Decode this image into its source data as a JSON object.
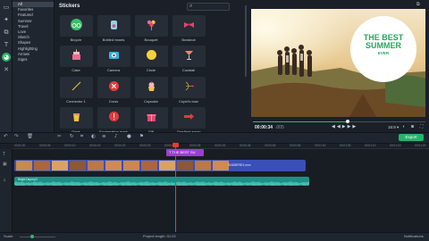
{
  "categories": [
    "All",
    "Favorites",
    "Featured",
    "Summer",
    "Travel",
    "Love",
    "Sketch",
    "Shapes",
    "Highlighting",
    "Arrows",
    "Signs"
  ],
  "stickers": {
    "title": "Stickers",
    "items": [
      "Bicycle",
      "Bottled hearts",
      "Bouquet",
      "Bowknot",
      "Cake",
      "Camera",
      "Circle",
      "Cocktail",
      "Connector 1",
      "Cross",
      "Cupcake",
      "Cupid's bow",
      "Drink",
      "Exclamation mark",
      "Gift",
      "Gradient arrow"
    ]
  },
  "preview": {
    "overlay_line1": "THE BEST",
    "overlay_line2": "SUMMER",
    "overlay_line3": "EVER",
    "time": "00:00:34",
    "time_frac": ".005",
    "aspect": "16:9 ▾"
  },
  "toolbar": {
    "export_label": "Export"
  },
  "ruler": [
    "00:00:00",
    "00:00:05",
    "00:00:10",
    "00:00:15",
    "00:00:20",
    "00:00:25",
    "00:00:30",
    "00:00:35",
    "00:00:40",
    "00:00:45",
    "00:00:50",
    "00:00:55",
    "00:01:00",
    "00:01:05",
    "00:01:10",
    "00:01:15",
    "00:01:20"
  ],
  "timeline": {
    "title_clip": "T THE BEST SU",
    "video_label": "SNS8ERE4.mov",
    "audio_label": "Bright Day.mp3"
  },
  "status": {
    "scale": "Scale:",
    "project_length": "Project length:  01:02",
    "notifications": "Notifications"
  },
  "colors": {
    "accent": "#27b36b",
    "title_clip": "#9a3fd6",
    "video_clip": "#3b4fb8",
    "audio_clip": "#1f8f86",
    "playhead": "#e53a3a"
  }
}
